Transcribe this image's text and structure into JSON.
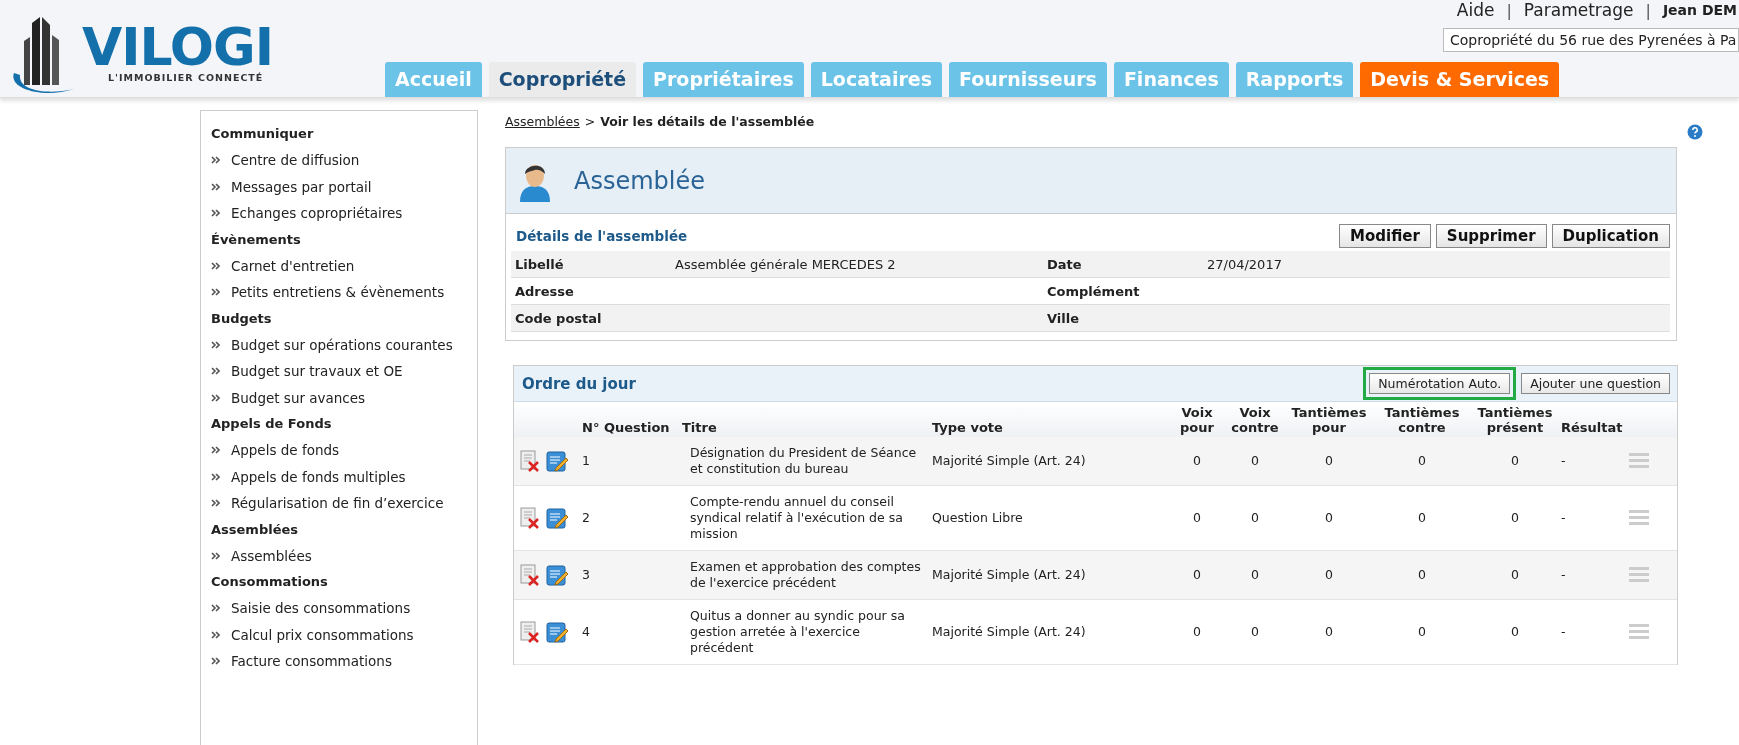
{
  "logo": {
    "name": "VILOGI",
    "tagline": "L'IMMOBILIER CONNECTÉ"
  },
  "top_links": [
    {
      "label": "Aide"
    },
    {
      "separator": "|",
      "label": "Parametrage"
    },
    {
      "separator": "|",
      "label": "Jean DEM"
    }
  ],
  "property_select": {
    "value": "Copropriété du 56 rue des Pyrenées à Pa"
  },
  "nav_tabs": [
    {
      "label": "Accueil",
      "selected": false,
      "kind": "normal"
    },
    {
      "label": "Copropriété",
      "selected": true,
      "kind": "normal"
    },
    {
      "label": "Propriétaires",
      "selected": false,
      "kind": "normal"
    },
    {
      "label": "Locataires",
      "selected": false,
      "kind": "normal"
    },
    {
      "label": "Fournisseurs",
      "selected": false,
      "kind": "normal"
    },
    {
      "label": "Finances",
      "selected": false,
      "kind": "normal"
    },
    {
      "label": "Rapports",
      "selected": false,
      "kind": "normal"
    },
    {
      "label": "Devis & Services",
      "selected": false,
      "kind": "promo"
    }
  ],
  "sidebar": {
    "sections": [
      {
        "title": "Communiquer",
        "items": [
          "Centre de diffusion",
          "Messages par portail",
          "Echanges copropriétaires"
        ]
      },
      {
        "title": "Évènements",
        "items": [
          "Carnet d'entretien",
          "Petits entretiens & évènements"
        ]
      },
      {
        "title": "Budgets",
        "items": [
          "Budget sur opérations courantes",
          "Budget sur travaux et OE",
          "Budget sur avances"
        ]
      },
      {
        "title": "Appels de Fonds",
        "items": [
          "Appels de fonds",
          "Appels de fonds multiples",
          "Régularisation de fin d’exercice"
        ]
      },
      {
        "title": "Assemblées",
        "items": [
          "Assemblées"
        ]
      },
      {
        "title": "Consommations",
        "items": [
          "Saisie des consommations",
          "Calcul prix consommations",
          "Facture consommations"
        ]
      }
    ]
  },
  "breadcrumb": {
    "link": "Assemblées",
    "separator": ">",
    "current": "Voir les détails de l'assemblée"
  },
  "panel": {
    "title": "Assemblée",
    "section_title": "Détails de l'assemblée",
    "buttons": [
      "Modifier",
      "Supprimer",
      "Duplication"
    ],
    "fields": [
      {
        "label": "Libellé",
        "value": "Assemblée générale MERCEDES 2",
        "label_2": "Date",
        "value_2": "27/04/2017"
      },
      {
        "label": "Adresse",
        "label_2": "Complément"
      },
      {
        "label": "Code postal",
        "label_2": "Ville"
      }
    ]
  },
  "agenda": {
    "title": "Ordre du jour",
    "buttons": [
      {
        "label": "Numérotation Auto.",
        "highlighted": true
      },
      {
        "label": "Ajouter une question",
        "highlighted": false
      }
    ],
    "columns": [
      "N° Question",
      "Titre",
      "Type vote",
      "Voix pour",
      "Voix contre",
      "Tantièmes pour",
      "Tantièmes contre",
      "Tantièmes présent",
      "Résultat"
    ],
    "rows": [
      {
        "cells": [
          "1",
          "Désignation du President de Séance et constitution du bureau",
          "Majorité Simple (Art. 24)",
          "0",
          "0",
          "0",
          "0",
          "0",
          "-"
        ]
      },
      {
        "cells": [
          "2",
          "Compte-rendu annuel du conseil syndical relatif à l'exécution de sa mission",
          "Question Libre",
          "0",
          "0",
          "0",
          "0",
          "0",
          "-"
        ]
      },
      {
        "cells": [
          "3",
          "Examen et approbation des comptes de l'exercice précédent",
          "Majorité Simple (Art. 24)",
          "0",
          "0",
          "0",
          "0",
          "0",
          "-"
        ]
      },
      {
        "cells": [
          "4",
          "Quitus a donner au syndic pour sa gestion arretée à l'exercice précédent",
          "Majorité Simple (Art. 24)",
          "0",
          "0",
          "0",
          "0",
          "0",
          "-"
        ]
      }
    ]
  }
}
